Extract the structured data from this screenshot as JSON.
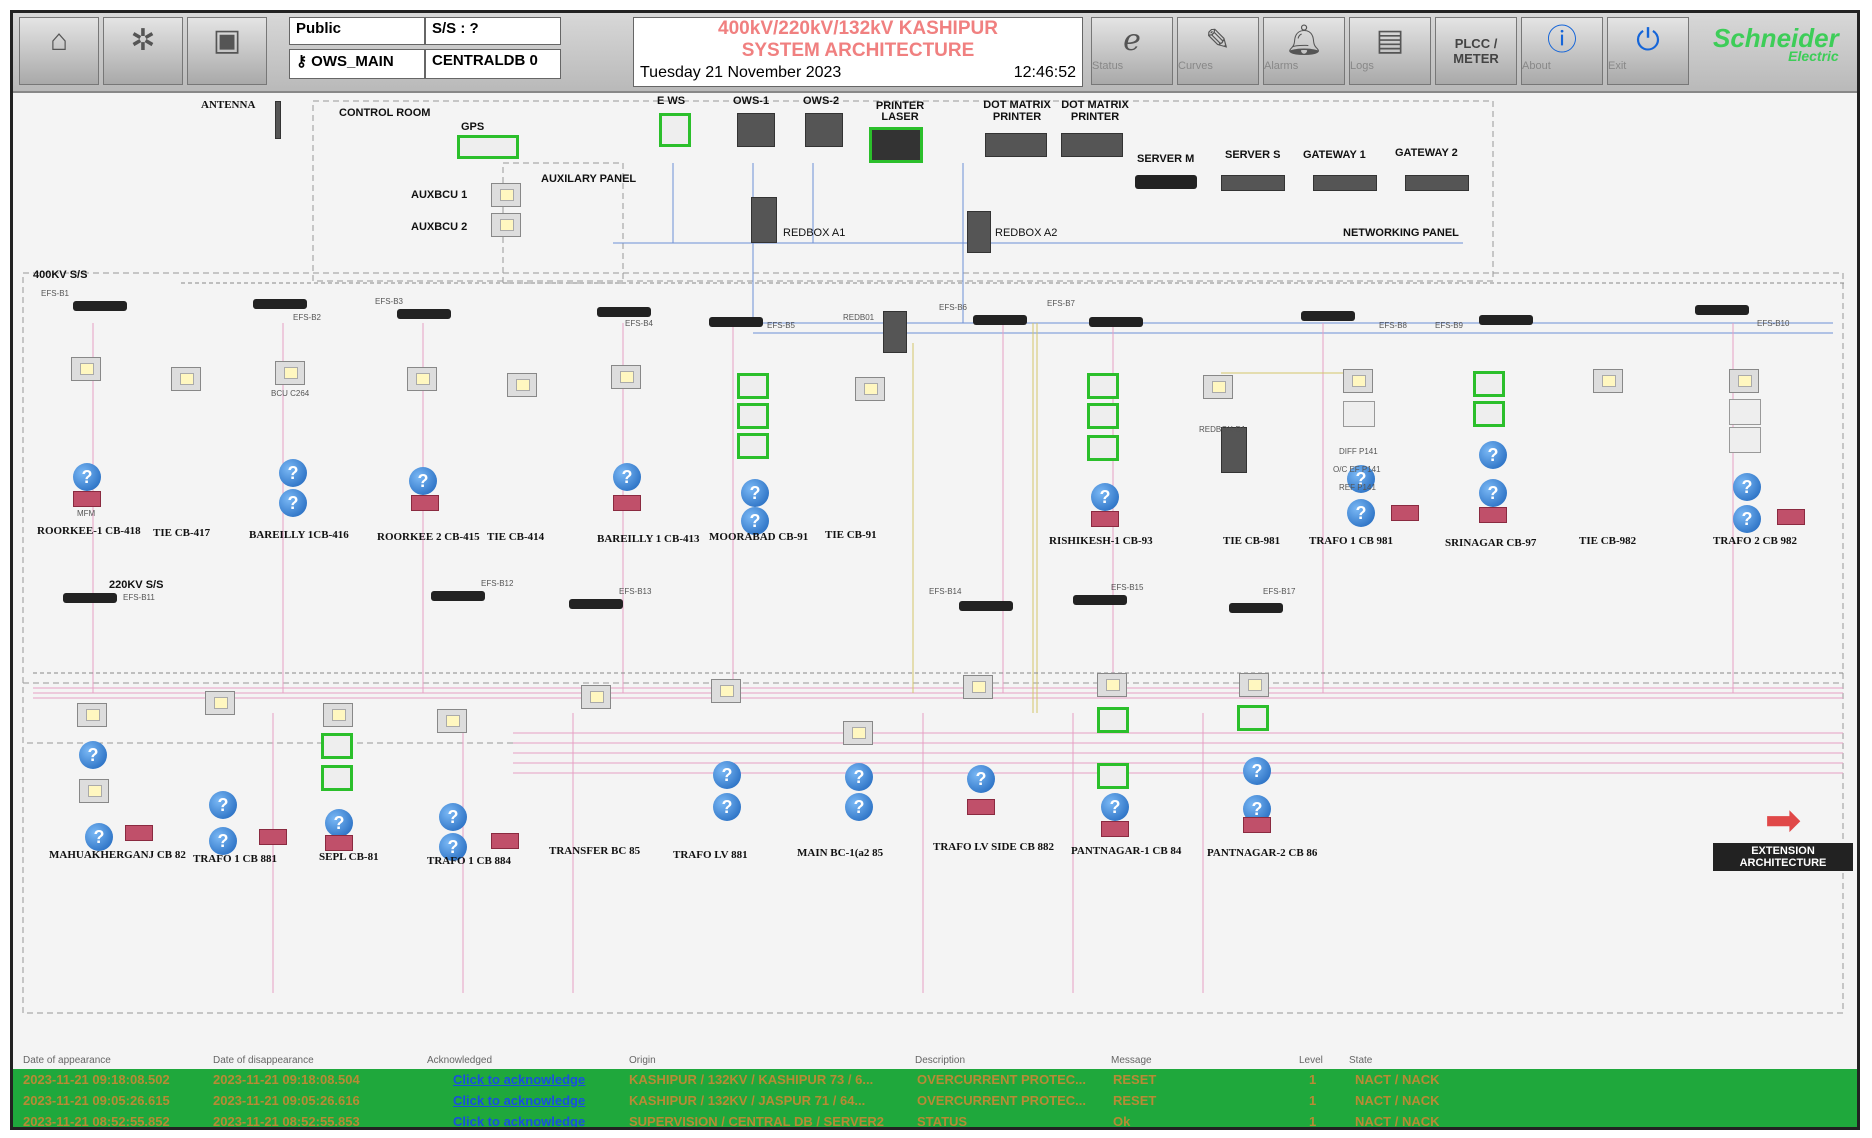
{
  "toolbar": {
    "left_buttons": [
      "",
      "",
      ""
    ],
    "public_label": "Public",
    "ss_label": "S/S :  ?",
    "user_field": "OWS_MAIN",
    "db_field": "CENTRALDB 0",
    "title_line1": "400kV/220kV/132kV KASHIPUR",
    "title_line2": "SYSTEM ARCHITECTURE",
    "date": "Tuesday 21 November 2023",
    "time": "12:46:52",
    "buttons": {
      "status": "Status",
      "curves": "Curves",
      "alarms": "Alarms",
      "logs": "Logs",
      "plcc_meter": "PLCC / METER",
      "about": "About",
      "exit": "Exit"
    },
    "logo_line1": "Schneider",
    "logo_line2": "Electric"
  },
  "control_room": {
    "antenna": "ANTENNA",
    "control_room": "CONTROL ROOM",
    "gps": "GPS",
    "auxiliary_panel": "AUXILARY PANEL",
    "auxbcu1": "AUXBCU 1",
    "auxbcu2": "AUXBCU 2",
    "ews": "E WS",
    "ows1": "OWS-1",
    "ows2": "OWS-2",
    "printer_laser": "PRINTER LASER",
    "dot_matrix1": "DOT MATRIX PRINTER",
    "dot_matrix2": "DOT MATRIX PRINTER",
    "server_m": "SERVER M",
    "server_s": "SERVER S",
    "gateway1": "GATEWAY 1",
    "gateway2": "GATEWAY 2",
    "redbox_a1": "REDBOX A1",
    "redbox_a2": "REDBOX A2",
    "networking_panel": "NETWORKING PANEL"
  },
  "ss400": {
    "label": "400KV S/S",
    "bays": [
      {
        "name": "ROORKEE-1 CB-418",
        "switch": "EFS-B1"
      },
      {
        "name": "TIE CB-417",
        "switch": ""
      },
      {
        "name": "BAREILLY 1CB-416",
        "switch": "EFS-B2"
      },
      {
        "name": "ROORKEE 2 CB-415",
        "switch": "EFS-B3"
      },
      {
        "name": "TIE CB-414",
        "switch": ""
      },
      {
        "name": "BAREILLY 1 CB-413",
        "switch": "EFS-B4"
      },
      {
        "name": "MOORABAD CB-91",
        "switch": "EFS-B5"
      },
      {
        "name": "TIE CB-91",
        "switch": "REDB01"
      },
      {
        "name": "RISHIKESH-1 CB-93",
        "switch": "EFS-B6"
      },
      {
        "name": "TIE CB-981",
        "switch": "EFS-B7"
      },
      {
        "name": "TRAFO 1 CB 981",
        "switch": "EFS-B8"
      },
      {
        "name": "SRINAGAR CB-97",
        "switch": "EFS-B9"
      },
      {
        "name": "TIE CB-982",
        "switch": ""
      },
      {
        "name": "TRAFO 2 CB 982",
        "switch": "EFS-B10"
      }
    ],
    "redbox_d1": "REDBOX-D1",
    "bcu": "BCU C264",
    "mfm": "MFM",
    "diff": "DIFF P141",
    "ref": "REF P141",
    "oc_ef": "O/C EF P141"
  },
  "ss220": {
    "label": "220KV S/S",
    "bays": [
      {
        "name": "MAHUAKHERGANJ CB 82",
        "switch": "EFS-B11"
      },
      {
        "name": "TRAFO 1 CB 881",
        "switch": ""
      },
      {
        "name": "SEPL CB-81",
        "switch": ""
      },
      {
        "name": "TRAFO 1 CB 884",
        "switch": "EFS-B12"
      },
      {
        "name": "TRANSFER BC 85",
        "switch": "EFS-B13"
      },
      {
        "name": "TRAFO LV 881",
        "switch": ""
      },
      {
        "name": "MAIN BC-1(a2 85",
        "switch": ""
      },
      {
        "name": "TRAFO LV SIDE CB 882",
        "switch": "EFS-B14"
      },
      {
        "name": "PANTNAGAR-1 CB 84",
        "switch": "EFS-B15"
      },
      {
        "name": "PANTNAGAR-2 CB 86",
        "switch": "EFS-B17"
      }
    ],
    "extension": "EXTENSION ARCHITECTURE"
  },
  "alarms": {
    "headers": [
      "Date of appearance",
      "Date of disappearance",
      "Acknowledged",
      "Origin",
      "Description",
      "Message",
      "Level",
      "State"
    ],
    "rows": [
      {
        "appearance": "2023-11-21 09:18:08.502",
        "disappearance": "2023-11-21 09:18:08.504",
        "ack": "Click to acknowledge",
        "origin": "KASHIPUR / 132KV / KASHIPUR 73 / 6...",
        "description": "OVERCURRENT PROTEC...",
        "message": "RESET",
        "level": "1",
        "state": "NACT / NACK"
      },
      {
        "appearance": "2023-11-21 09:05:26.615",
        "disappearance": "2023-11-21 09:05:26.616",
        "ack": "Click to acknowledge",
        "origin": "KASHIPUR / 132KV / JASPUR 71 / 64...",
        "description": "OVERCURRENT PROTEC...",
        "message": "RESET",
        "level": "1",
        "state": "NACT / NACK"
      },
      {
        "appearance": "2023-11-21 08:52:55.852",
        "disappearance": "2023-11-21 08:52:55.853",
        "ack": "Click to acknowledge",
        "origin": "SUPERVISION / CENTRAL DB / SERVER2",
        "description": "STATUS",
        "message": "Ok",
        "level": "1",
        "state": "NACT / NACK"
      }
    ]
  }
}
